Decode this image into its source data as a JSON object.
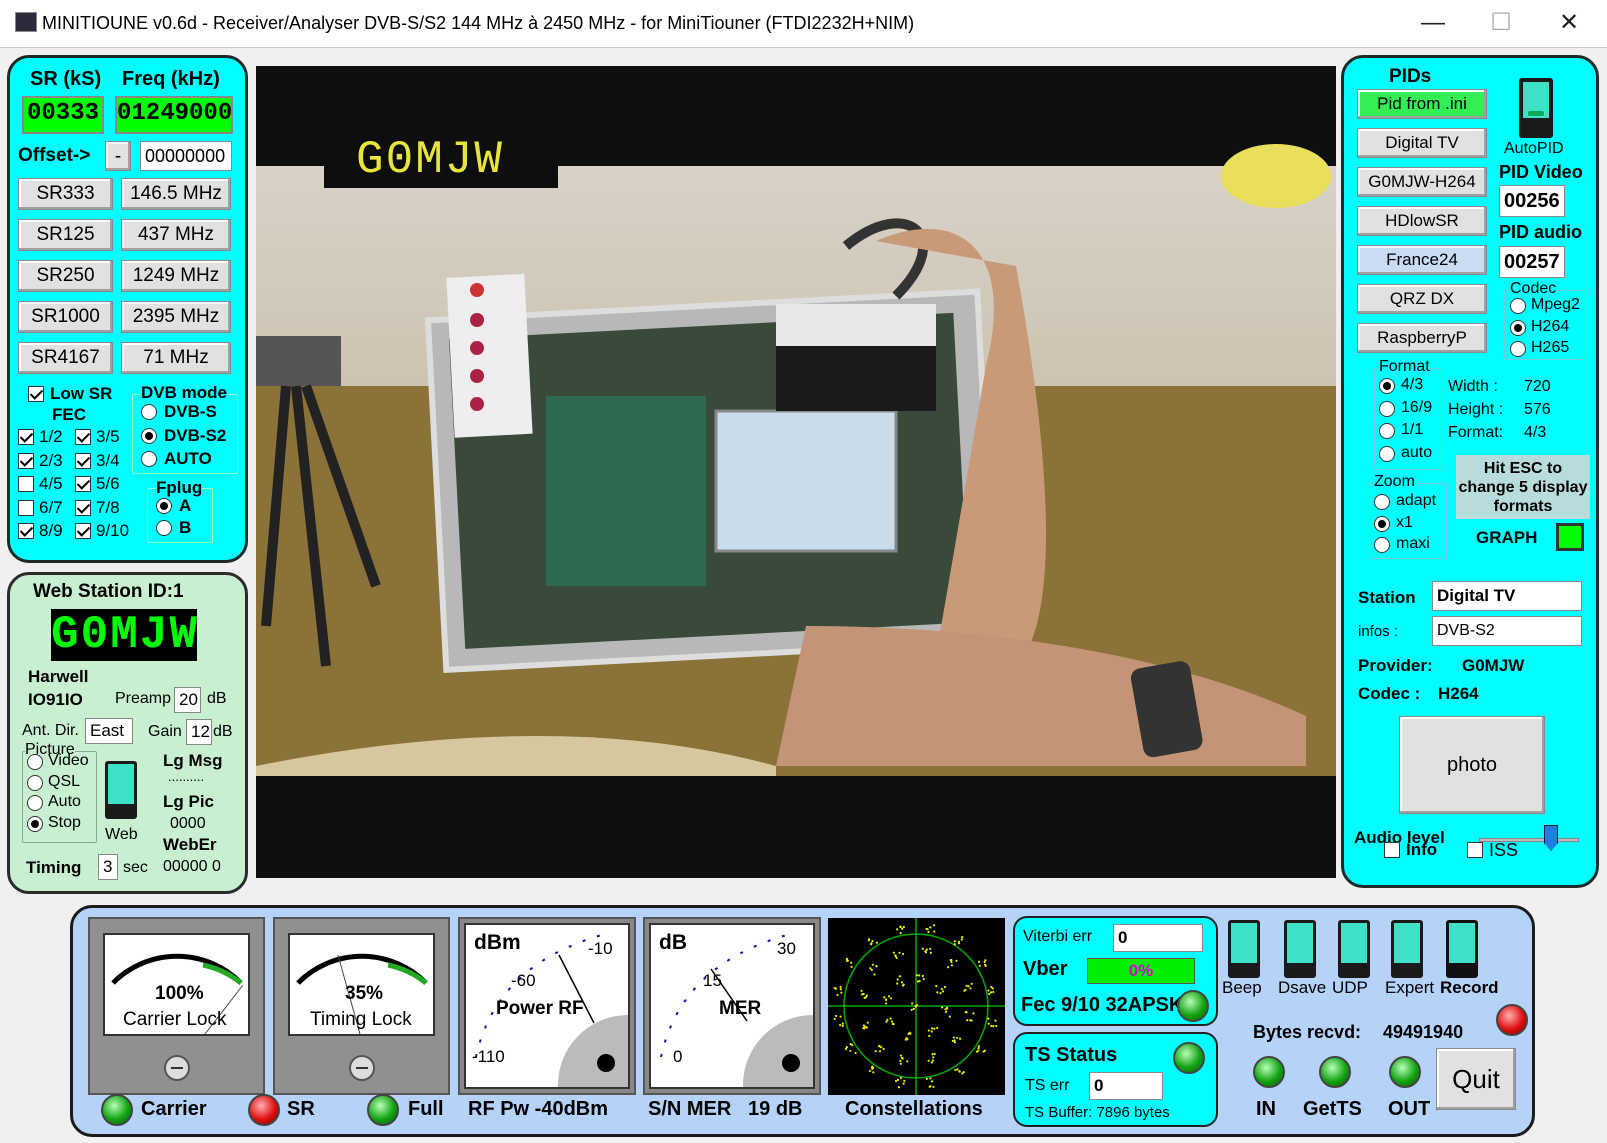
{
  "window": {
    "title": "MINITIOUNE v0.6d - Receiver/Analyser DVB-S/S2 144 MHz à 2450 MHz - for MiniTiouner (FTDI2232H+NIM)",
    "minimize": "—",
    "maximize": "☐",
    "close": "✕"
  },
  "tuning": {
    "sr_header": "SR (kS)",
    "freq_header": "Freq (kHz)",
    "sr_value": "00333",
    "freq_value": "01249000",
    "offset_label": "Offset->",
    "offset_sign": "-",
    "offset_value": "00000000",
    "sr_buttons": [
      "SR333",
      "SR125",
      "SR250",
      "SR1000",
      "SR4167"
    ],
    "freq_buttons": [
      "146.5 MHz",
      "437 MHz",
      "1249 MHz",
      "2395 MHz",
      "71 MHz"
    ],
    "low_sr": "Low SR",
    "fec_label": "FEC",
    "fec": [
      {
        "label": "1/2",
        "checked": true
      },
      {
        "label": "3/5",
        "checked": true
      },
      {
        "label": "2/3",
        "checked": true
      },
      {
        "label": "3/4",
        "checked": true
      },
      {
        "label": "4/5",
        "checked": false
      },
      {
        "label": "5/6",
        "checked": true
      },
      {
        "label": "6/7",
        "checked": false
      },
      {
        "label": "7/8",
        "checked": true
      },
      {
        "label": "8/9",
        "checked": true
      },
      {
        "label": "9/10",
        "checked": true
      }
    ],
    "dvb_mode_label": "DVB mode",
    "dvb_modes": [
      "DVB-S",
      "DVB-S2",
      "AUTO"
    ],
    "dvb_selected": "DVB-S2",
    "fplug_label": "Fplug",
    "fplug": [
      "A",
      "B"
    ],
    "fplug_selected": "A"
  },
  "web": {
    "title": "Web Station ID:1",
    "callsign_display": "G0MJW",
    "location": "Harwell",
    "locator": "IO91IO",
    "preamp_label": "Preamp",
    "preamp_value": "20",
    "db": "dB",
    "antdir_label": "Ant. Dir.",
    "antdir_value": "East",
    "gain_label": "Gain",
    "gain_value": "12",
    "picture_label": "Picture",
    "picture_options": [
      "Video",
      "QSL",
      "Auto",
      "Stop"
    ],
    "picture_selected": "Stop",
    "web_switch": "Web",
    "lg_msg": "Lg Msg",
    "lg_msg_value": "..........",
    "lg_pic": "Lg Pic",
    "lg_pic_value": "0000",
    "weber": "WebEr",
    "weber_value": "00000 0",
    "timing_label": "Timing",
    "timing_value": "3",
    "sec": "sec"
  },
  "video": {
    "overlay_callsign": "G0MJW"
  },
  "pids": {
    "title": "PIDs",
    "buttons": [
      "Pid from .ini",
      "Digital TV",
      "G0MJW-H264",
      "HDlowSR",
      "France24",
      "QRZ DX",
      "RaspberryP"
    ],
    "autopid": "AutoPID",
    "pid_video_label": "PID Video",
    "pid_video": "00256",
    "pid_audio_label": "PID audio",
    "pid_audio": "00257",
    "codec_label": "Codec",
    "codecs": [
      "Mpeg2",
      "H264",
      "H265"
    ],
    "codec_selected": "H264",
    "format_label": "Format",
    "formats": [
      "4/3",
      "16/9",
      "1/1",
      "auto"
    ],
    "format_selected": "4/3",
    "width_label": "Width :",
    "width": "720",
    "height_label": "Height :",
    "height": "576",
    "fmt_label": "Format:",
    "fmt": "4/3",
    "esc_note": "Hit ESC to change 5 display formats",
    "zoom_label": "Zoom",
    "zooms": [
      "adapt",
      "x1",
      "maxi"
    ],
    "zoom_selected": "x1",
    "graph_label": "GRAPH",
    "station_label": "Station",
    "station_value": "Digital TV",
    "infos_label": "infos :",
    "infos_value": "DVB-S2",
    "provider_label": "Provider:",
    "provider_value": "G0MJW",
    "codec_info_label": "Codec :",
    "codec_info_value": "H264",
    "photo": "photo",
    "audio_level_label": "Audio level",
    "audio_level": 0.72,
    "info": "Info",
    "iss": "ISS"
  },
  "status": {
    "carrier_pct": "100%",
    "carrier_label": "Carrier Lock",
    "timing_pct": "35%",
    "timing_label": "Timing Lock",
    "rf_unit": "dBm",
    "rf_ticks": [
      "-10",
      "-60",
      "-110"
    ],
    "rf_title": "Power RF",
    "mer_unit": "dB",
    "mer_ticks": [
      "30",
      "15",
      "0"
    ],
    "mer_title": "MER",
    "viterbi_label": "Viterbi err",
    "viterbi_value": "0",
    "vber_label": "Vber",
    "vber_value": "0%",
    "fec_status": "Fec 9/10 32APSK",
    "ts_status": "TS Status",
    "ts_err_label": "TS err",
    "ts_err_value": "0",
    "ts_buffer": "TS Buffer: 7896 bytes",
    "switches": [
      "Beep",
      "Dsave",
      "UDP",
      "Expert",
      "Record"
    ],
    "bytes_label": "Bytes recvd:",
    "bytes_value": "49491940",
    "quit": "Quit",
    "bottom": {
      "carrier": "Carrier",
      "sr": "SR",
      "full": "Full",
      "rf_pw": "RF Pw -40dBm",
      "sn_mer": "S/N MER   19 dB",
      "constellations": "Constellations",
      "in": "IN",
      "getts": "GetTS",
      "out": "OUT"
    }
  }
}
